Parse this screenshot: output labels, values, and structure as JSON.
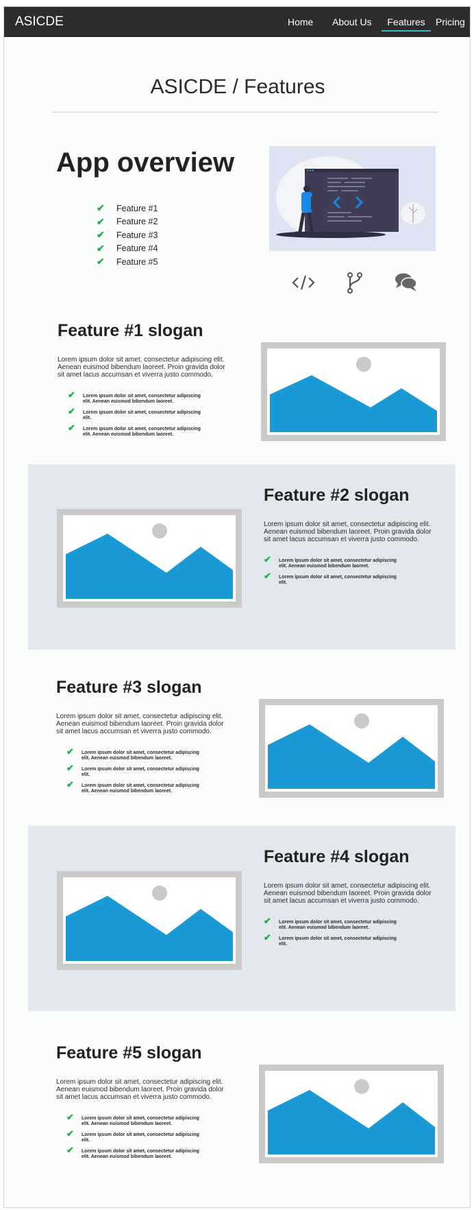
{
  "nav": {
    "brand": "ASICDE",
    "links": [
      {
        "label": "Home",
        "active": false
      },
      {
        "label": "About Us",
        "active": false
      },
      {
        "label": "Features",
        "active": true
      },
      {
        "label": "Pricing",
        "active": false
      }
    ]
  },
  "page_title": "ASICDE / Features",
  "overview": {
    "title": "App overview",
    "features": [
      "Feature #1",
      "Feature #2",
      "Feature #3",
      "Feature #4",
      "Feature #5"
    ],
    "icons": [
      "code-icon",
      "branch-icon",
      "comments-icon"
    ]
  },
  "sections": [
    {
      "title": "Feature #1 slogan",
      "body": "Lorem ipsum dolor sit amet, consectetur adipiscing elit. Aenean euismod bibendum laoreet. Proin gravida dolor sit amet lacus accumsan et viverra justo commodo.",
      "bullets": [
        "Lorem ipsum dolor sit amet, consectetur adipiscing elit. Aenean euismod bibendum laoreet.",
        "Lorem ipsum dolor sit amet, consectetur adipiscing elit.",
        "Lorem ipsum dolor sit amet, consectetur adipiscing elit. Aenean euismod bibendum laoreet."
      ]
    },
    {
      "title": "Feature #2 slogan",
      "body": "Lorem ipsum dolor sit amet, consectetur adipiscing elit. Aenean euismod bibendum laoreet. Proin gravida dolor sit amet lacus accumsan et viverra justo commodo.",
      "bullets": [
        "Lorem ipsum dolor sit amet, consectetur adipiscing elit. Aenean euismod bibendum laoreet.",
        "Lorem ipsum dolor sit amet, consectetur adipiscing elit."
      ]
    },
    {
      "title": "Feature #3 slogan",
      "body": "Lorem ipsum dolor sit amet, consectetur adipiscing elit. Aenean euismod bibendum laoreet. Proin gravida dolor sit amet lacus accumsan et viverra justo commodo.",
      "bullets": [
        "Lorem ipsum dolor sit amet, consectetur adipiscing elit. Aenean euismod bibendum laoreet.",
        "Lorem ipsum dolor sit amet, consectetur adipiscing elit.",
        "Lorem ipsum dolor sit amet, consectetur adipiscing elit. Aenean euismod bibendum laoreet."
      ]
    },
    {
      "title": "Feature #4 slogan",
      "body": "Lorem ipsum dolor sit amet, consectetur adipiscing elit. Aenean euismod bibendum laoreet. Proin gravida dolor sit amet lacus accumsan et viverra justo commodo.",
      "bullets": [
        "Lorem ipsum dolor sit amet, consectetur adipiscing elit. Aenean euismod bibendum laoreet.",
        "Lorem ipsum dolor sit amet, consectetur adipiscing elit."
      ]
    },
    {
      "title": "Feature #5 slogan",
      "body": "Lorem ipsum dolor sit amet, consectetur adipiscing elit. Aenean euismod bibendum laoreet. Proin gravida dolor sit amet lacus accumsan et viverra justo commodo.",
      "bullets": [
        "Lorem ipsum dolor sit amet, consectetur adipiscing elit. Aenean euismod bibendum laoreet.",
        "Lorem ipsum dolor sit amet, consectetur adipiscing elit.",
        "Lorem ipsum dolor sit amet, consectetur adipiscing elit. Aenean euismod bibendum laoreet."
      ]
    }
  ],
  "colors": {
    "navbar": "#2c2c2c",
    "accent_underline": "#36b3c9",
    "check": "#19b14b",
    "band": "#e2e8ed",
    "placeholder_blue": "#1a99d4",
    "placeholder_frame": "#c9c9c9"
  }
}
